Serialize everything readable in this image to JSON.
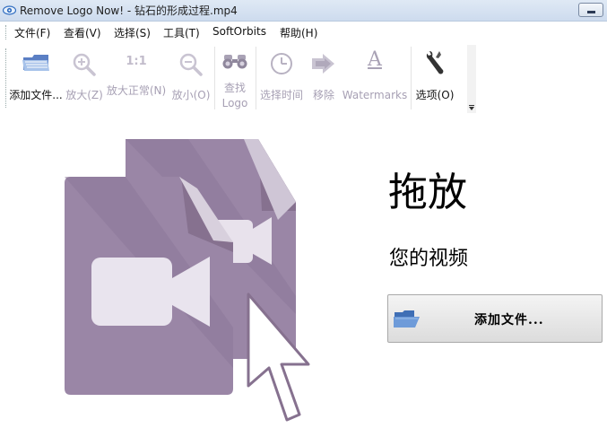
{
  "window": {
    "title": "Remove Logo Now! - 钻石的形成过程.mp4",
    "app_icon": "app-eye-icon"
  },
  "menu": {
    "items": [
      {
        "label": "文件(F)"
      },
      {
        "label": "查看(V)"
      },
      {
        "label": "选择(S)"
      },
      {
        "label": "工具(T)"
      },
      {
        "label": "SoftOrbits"
      },
      {
        "label": "帮助(H)"
      }
    ]
  },
  "toolbar": {
    "add_file": {
      "label": "添加文件...",
      "icon": "folder-blue-icon",
      "enabled": true
    },
    "zoom_in": {
      "label": "放大(Z)",
      "icon": "zoom-in-icon",
      "enabled": false
    },
    "zoom_normal": {
      "label": "放大正常(N)",
      "icon": "one-to-one-icon",
      "glyph": "1:1",
      "enabled": false
    },
    "zoom_out": {
      "label": "放小(O)",
      "icon": "zoom-out-icon",
      "enabled": false
    },
    "find_logo": {
      "label_line1": "查找",
      "label_line2": "Logo",
      "icon": "binoculars-icon",
      "enabled": false
    },
    "select_time": {
      "label": "选择时间",
      "icon": "clock-icon",
      "enabled": false
    },
    "remove": {
      "label": "移除",
      "icon": "arrow-right-icon",
      "enabled": false
    },
    "watermarks": {
      "label": "Watermarks",
      "icon": "letter-a-icon",
      "glyph": "A",
      "enabled": false
    },
    "options": {
      "label": "选项(O)",
      "icon": "wrench-icon",
      "enabled": true
    }
  },
  "drop_area": {
    "title": "拖放",
    "subtitle": "您的视频",
    "add_button_label": "添加文件...",
    "add_button_icon": "folder-open-icon"
  },
  "colors": {
    "accent_purple": "#9a86a6",
    "purple_dark": "#86718f",
    "disabled_text": "#a7a0b4"
  }
}
